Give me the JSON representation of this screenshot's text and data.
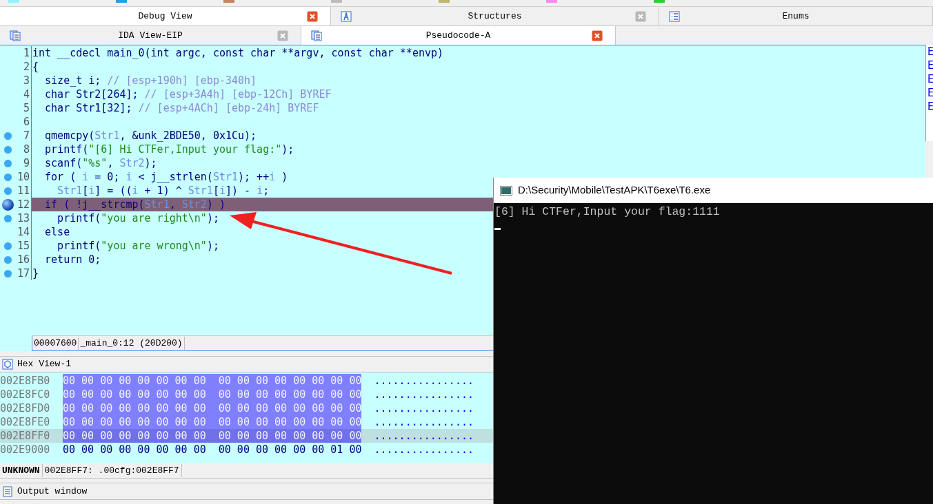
{
  "top_strip": {
    "swatches": [
      {
        "color": "#99eeff"
      },
      {
        "color": "#22a0e8"
      },
      {
        "color": "#c8845c"
      },
      {
        "color": "#bbbbbb"
      },
      {
        "color": "#bdb76b"
      },
      {
        "color": "#ff88ee"
      },
      {
        "color": "#33cc33"
      }
    ]
  },
  "tab_rows": [
    [
      {
        "label": "Debug View",
        "selected": true,
        "closable": true
      },
      {
        "label": "Structures",
        "selected": false,
        "closable": true
      },
      {
        "label": "Enums",
        "selected": false,
        "closable": false
      }
    ],
    [
      {
        "label": "IDA View-EIP",
        "selected": false,
        "closable": true
      },
      {
        "label": "Pseudocode-A",
        "selected": true,
        "closable": true
      }
    ]
  ],
  "code_lines": [
    {
      "number": "1",
      "kind": "plain",
      "selected": false,
      "segments": [
        {
          "text": "int __cdecl main_0(int argc, const char **argv, const char **envp)",
          "kind": "code"
        }
      ]
    },
    {
      "number": "2",
      "kind": "plain",
      "selected": false,
      "segments": [
        {
          "text": "{",
          "kind": "code"
        }
      ]
    },
    {
      "number": "3",
      "kind": "plain",
      "selected": false,
      "segments": [
        {
          "text": "  size_t i; ",
          "kind": "code"
        },
        {
          "text": "// [esp+190h] [ebp-340h]",
          "kind": "comment"
        }
      ]
    },
    {
      "number": "4",
      "kind": "plain",
      "selected": false,
      "segments": [
        {
          "text": "  char Str2[264]; ",
          "kind": "code"
        },
        {
          "text": "// [esp+3A4h] [ebp-12Ch] BYREF",
          "kind": "comment"
        }
      ]
    },
    {
      "number": "5",
      "kind": "plain",
      "selected": false,
      "segments": [
        {
          "text": "  char Str1[32]; ",
          "kind": "code"
        },
        {
          "text": "// [esp+4ACh] [ebp-24h] BYREF",
          "kind": "comment"
        }
      ]
    },
    {
      "number": "6",
      "kind": "plain",
      "selected": false
    },
    {
      "number": "7",
      "kind": "breakpoint",
      "selected": false,
      "segments": [
        {
          "text": "  qmemcpy(",
          "kind": "code"
        },
        {
          "text": "Str1",
          "kind": "variable"
        },
        {
          "text": ", &unk_2BDE50, 0x1Cu);",
          "kind": "code"
        }
      ]
    },
    {
      "number": "8",
      "kind": "breakpoint",
      "selected": false,
      "segments": [
        {
          "text": "  printf(",
          "kind": "code"
        },
        {
          "text": "\"[6] Hi CTFer,Input your flag:\"",
          "kind": "string"
        },
        {
          "text": ");",
          "kind": "code"
        }
      ]
    },
    {
      "number": "9",
      "kind": "breakpoint",
      "selected": false,
      "segments": [
        {
          "text": "  scanf(",
          "kind": "code"
        },
        {
          "text": "\"%s\"",
          "kind": "string"
        },
        {
          "text": ", ",
          "kind": "code"
        },
        {
          "text": "Str2",
          "kind": "variable"
        },
        {
          "text": ");",
          "kind": "code"
        }
      ]
    },
    {
      "number": "10",
      "kind": "breakpoint",
      "selected": false,
      "segments": [
        {
          "text": "  for ( ",
          "kind": "code"
        },
        {
          "text": "i",
          "kind": "variable"
        },
        {
          "text": " = 0; ",
          "kind": "code"
        },
        {
          "text": "i",
          "kind": "variable"
        },
        {
          "text": " < j__strlen(",
          "kind": "code"
        },
        {
          "text": "Str1",
          "kind": "variable"
        },
        {
          "text": "); ++",
          "kind": "code"
        },
        {
          "text": "i",
          "kind": "variable"
        },
        {
          "text": " )",
          "kind": "code"
        }
      ]
    },
    {
      "number": "11",
      "kind": "breakpoint",
      "selected": false,
      "segments": [
        {
          "text": "    Str1",
          "kind": "variable"
        },
        {
          "text": "[",
          "kind": "code"
        },
        {
          "text": "i",
          "kind": "variable"
        },
        {
          "text": "] = ((",
          "kind": "code"
        },
        {
          "text": "i",
          "kind": "variable"
        },
        {
          "text": " + 1) ^ ",
          "kind": "code"
        },
        {
          "text": "Str1",
          "kind": "variable"
        },
        {
          "text": "[",
          "kind": "code"
        },
        {
          "text": "i",
          "kind": "variable"
        },
        {
          "text": "]) - ",
          "kind": "code"
        },
        {
          "text": "i",
          "kind": "variable"
        },
        {
          "text": ";",
          "kind": "code"
        }
      ]
    },
    {
      "number": "12",
      "kind": "current",
      "selected": true,
      "segments": [
        {
          "text": "  if ( !j__strcmp(",
          "kind": "code"
        },
        {
          "text": "Str1",
          "kind": "variable"
        },
        {
          "text": ", ",
          "kind": "code"
        },
        {
          "text": "Str2",
          "kind": "variable"
        },
        {
          "text": ") )",
          "kind": "code"
        }
      ]
    },
    {
      "number": "13",
      "kind": "breakpoint",
      "selected": false,
      "segments": [
        {
          "text": "    printf(",
          "kind": "code"
        },
        {
          "text": "\"you are right\\n\"",
          "kind": "string"
        },
        {
          "text": ");",
          "kind": "code"
        }
      ]
    },
    {
      "number": "14",
      "kind": "plain",
      "selected": false,
      "segments": [
        {
          "text": "  else",
          "kind": "code"
        }
      ]
    },
    {
      "number": "15",
      "kind": "breakpoint",
      "selected": false,
      "segments": [
        {
          "text": "    printf(",
          "kind": "code"
        },
        {
          "text": "\"you are wrong\\n\"",
          "kind": "string"
        },
        {
          "text": ");",
          "kind": "code"
        }
      ]
    },
    {
      "number": "16",
      "kind": "breakpoint",
      "selected": false,
      "segments": [
        {
          "text": "  return 0;",
          "kind": "code"
        }
      ]
    },
    {
      "number": "17",
      "kind": "breakpoint",
      "selected": false,
      "segments": [
        {
          "text": "}",
          "kind": "code"
        }
      ]
    }
  ],
  "code_status": [
    "00007600",
    "_main_0:12 (20D200)"
  ],
  "hex_view": {
    "title": "Hex View-1",
    "rows": [
      {
        "address": "002E8FB0",
        "bytes": "00 00 00 00 00 00 00 00  00 00 00 00 00 00 00 00",
        "ascii": "................",
        "highlighted": true,
        "selected": false
      },
      {
        "address": "002E8FC0",
        "bytes": "00 00 00 00 00 00 00 00  00 00 00 00 00 00 00 00",
        "ascii": "................",
        "highlighted": true,
        "selected": false
      },
      {
        "address": "002E8FD0",
        "bytes": "00 00 00 00 00 00 00 00  00 00 00 00 00 00 00 00",
        "ascii": "................",
        "highlighted": true,
        "selected": false
      },
      {
        "address": "002E8FE0",
        "bytes": "00 00 00 00 00 00 00 00  00 00 00 00 00 00 00 00",
        "ascii": "................",
        "highlighted": true,
        "selected": false
      },
      {
        "address": "002E8FF0",
        "bytes": "00 00 00 00 00 00 00 00  00 00 00 00 00 00 00 00",
        "ascii": "................",
        "highlighted": true,
        "selected": true
      },
      {
        "address": "002E9000",
        "bytes": "00 00 00 00 00 00 00 00  00 00 00 00 00 00 01 00",
        "ascii": "................",
        "highlighted": false,
        "selected": false
      }
    ],
    "status": [
      "UNKNOWN",
      "002E8FF7: .00cfg:002E8FF7"
    ]
  },
  "output_window": {
    "title": "Output window"
  },
  "right_panel": {
    "items": [
      "E",
      "E",
      "E",
      "E",
      "E"
    ]
  },
  "console": {
    "title": "D:\\Security\\Mobile\\TestAPK\\T6exe\\T6.exe",
    "lines": [
      "[6] Hi CTFer,Input your flag:1111"
    ]
  }
}
